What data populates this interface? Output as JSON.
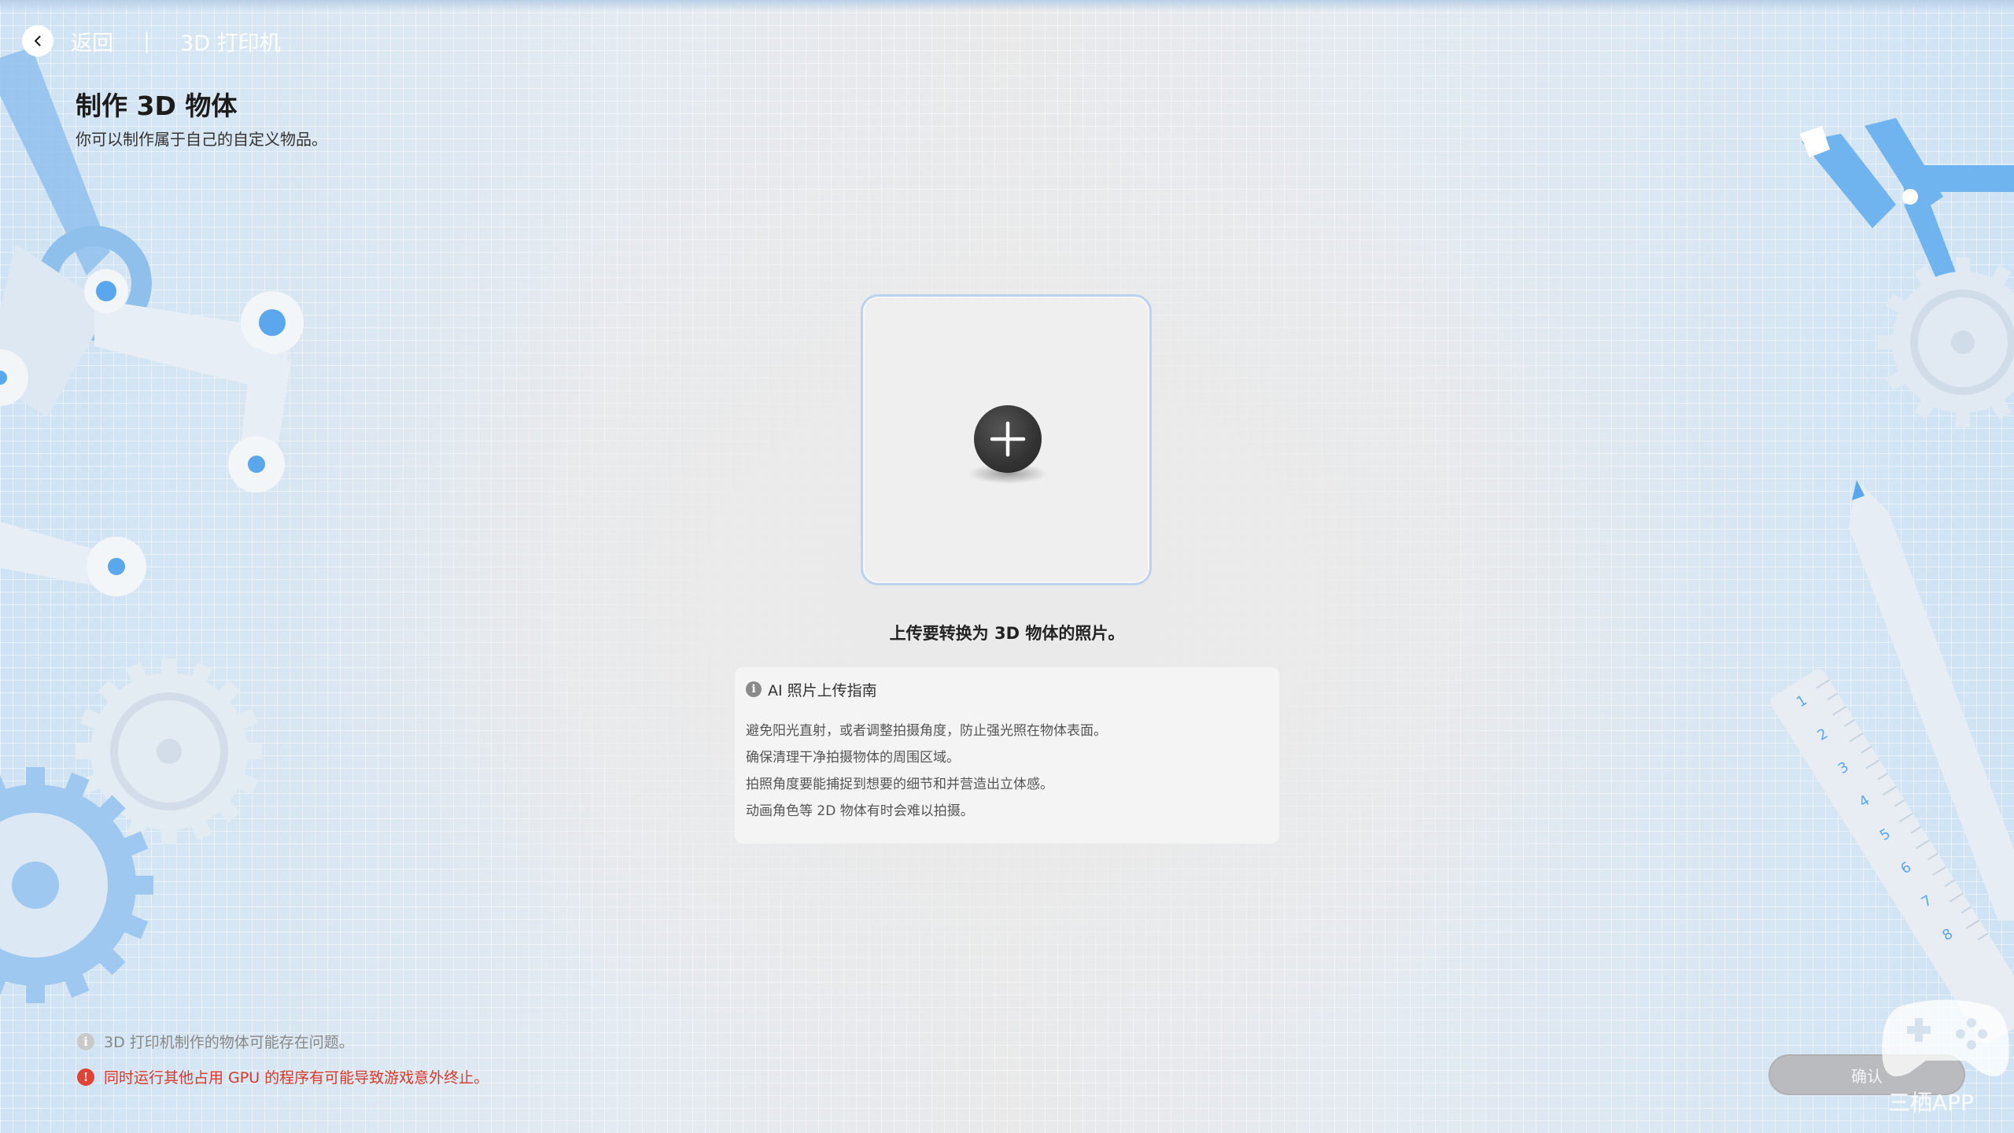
{
  "header": {
    "back_label": "返回",
    "separator": "|",
    "current_page": "3D 打印机"
  },
  "page": {
    "title": "制作 3D 物体",
    "subtitle": "你可以制作属于自己的自定义物品。"
  },
  "upload": {
    "caption": "上传要转换为 3D 物体的照片。"
  },
  "guide": {
    "title": "AI 照片上传指南",
    "lines": [
      "避免阳光直射，或者调整拍摄角度，防止强光照在物体表面。",
      "确保清理干净拍摄物体的周围区域。",
      "拍照角度要能捕捉到想要的细节和并营造出立体感。",
      "动画角色等 2D 物体有时会难以拍摄。"
    ]
  },
  "notices": [
    {
      "text": "3D 打印机制作的物体可能存在问题。",
      "level": "info",
      "color": "#888888"
    },
    {
      "text": "同时运行其他占用 GPU 的程序有可能导致游戏意外终止。",
      "level": "warning",
      "color": "#d8392b"
    }
  ],
  "confirm_label": "确认",
  "watermark": "三栖APP",
  "ruler_numbers": [
    "1",
    "2",
    "3",
    "4",
    "5",
    "6",
    "7",
    "8"
  ],
  "colors": {
    "accent_blue": "#5aa7ee",
    "frame_border": "#bcd3ef",
    "warning_red": "#e04336"
  }
}
